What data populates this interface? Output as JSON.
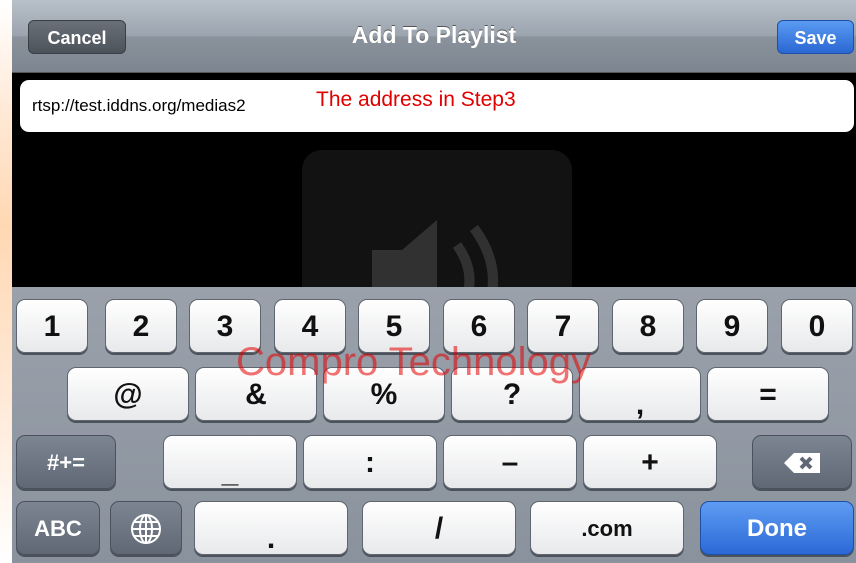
{
  "navbar": {
    "cancel_label": "Cancel",
    "title": "Add To Playlist",
    "save_label": "Save"
  },
  "address_field": {
    "value": "rtsp://test.iddns.org/medias2",
    "annotation": "The address in Step3"
  },
  "watermark": "Compro Technology",
  "keyboard": {
    "row1": [
      "1",
      "2",
      "3",
      "4",
      "5",
      "6",
      "7",
      "8",
      "9",
      "0"
    ],
    "row2": [
      "@",
      "&",
      "%",
      "?",
      ",",
      "="
    ],
    "row3": {
      "toggle": "#+=",
      "keys": [
        "_",
        ":",
        "–",
        "+"
      ],
      "delete_icon": "delete-icon"
    },
    "row4": {
      "abc": "ABC",
      "globe_icon": "globe-icon",
      "keys": [
        ".",
        "/",
        ".com"
      ],
      "done": "Done"
    }
  },
  "colors": {
    "save_blue": "#2a67d3",
    "annotation_red": "#e00000",
    "keyboard_bg": "#9aa1ab"
  }
}
